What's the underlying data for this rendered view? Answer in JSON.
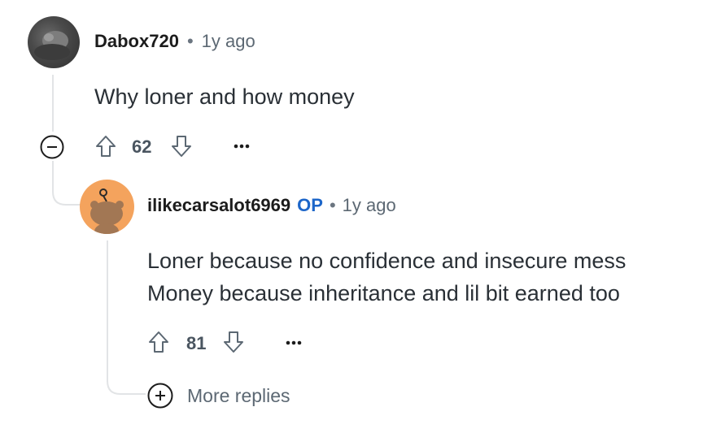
{
  "comments": [
    {
      "username": "Dabox720",
      "separator": "•",
      "time": "1y ago",
      "body": [
        "Why loner and how money"
      ],
      "votes": "62",
      "avatar": "gray-photo-avatar"
    },
    {
      "username": "ilikecarsalot6969",
      "op_label": "OP",
      "separator": "•",
      "time": "1y ago",
      "body": [
        "Loner because no confidence and insecure mess",
        "Money because inheritance and lil bit earned too"
      ],
      "votes": "81",
      "avatar": "orange-snoo-avatar"
    }
  ],
  "more_replies": {
    "label": "More replies",
    "icon": "plus-circle-icon"
  },
  "icons": {
    "collapse": "minus-circle-icon",
    "upvote": "upvote-arrow-icon",
    "downvote": "downvote-arrow-icon",
    "overflow": "ellipsis-icon"
  },
  "colors": {
    "op": "#1d66c9",
    "avatar_orange": "#f4a35d",
    "thread_line": "#e2e4e6"
  }
}
